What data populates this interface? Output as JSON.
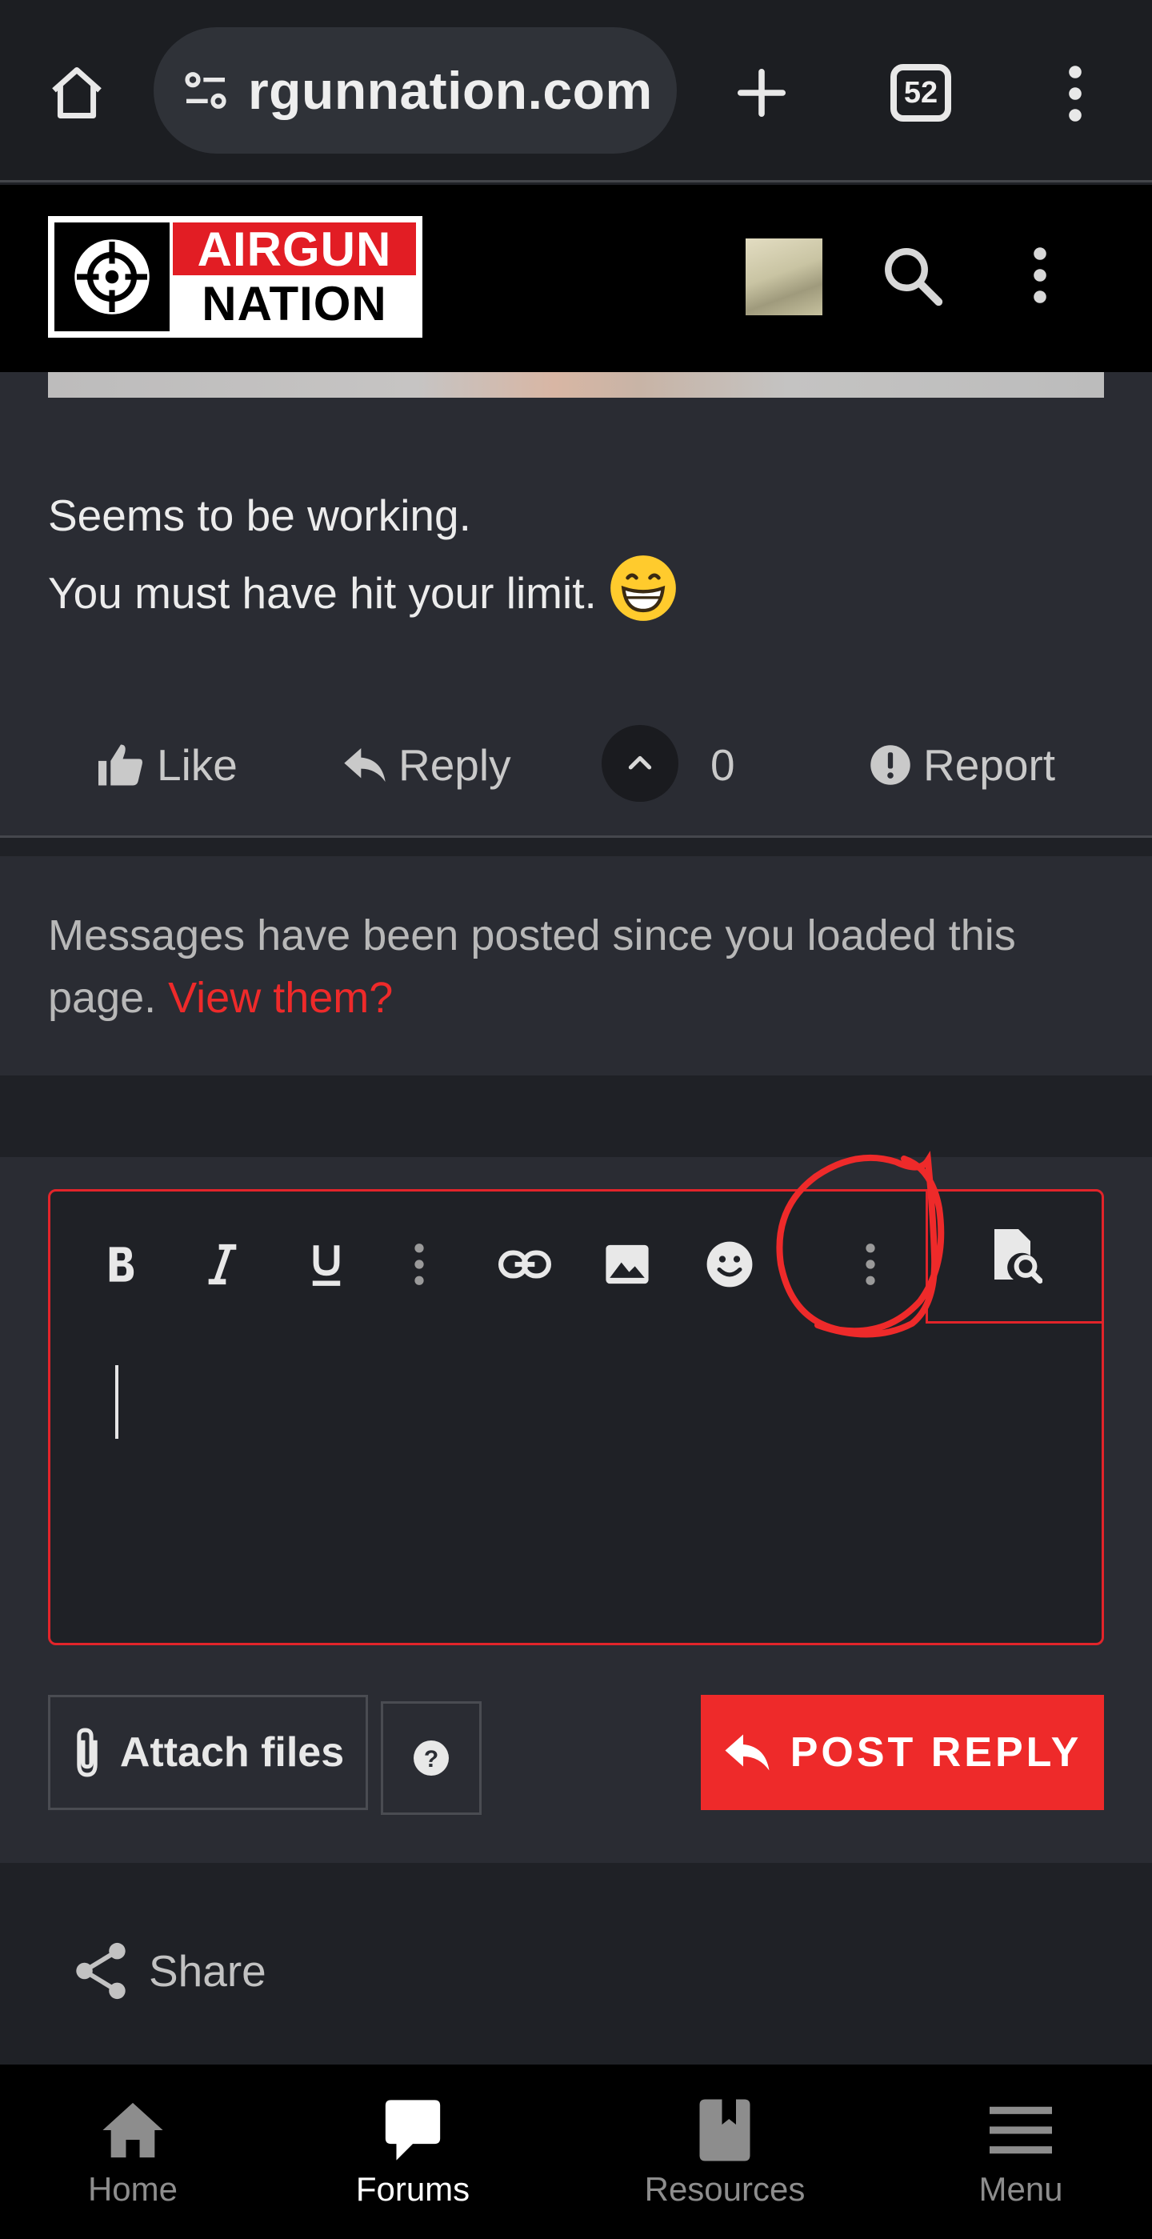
{
  "browser": {
    "url": "rgunnation.com",
    "tab_count": "52"
  },
  "site": {
    "logo_top": "AIRGUN",
    "logo_bottom": "NATION"
  },
  "post": {
    "line1": "Seems to be working.",
    "line2": "You must have hit your limit.",
    "actions": {
      "like": "Like",
      "reply": "Reply",
      "vote_count": "0",
      "report": "Report"
    }
  },
  "notice": {
    "text": "Messages have been posted since you loaded this page. ",
    "link": "View them?"
  },
  "editor": {
    "toolbar": [
      "bold",
      "italic",
      "underline",
      "more",
      "link",
      "image",
      "emoji",
      "more",
      "preview"
    ],
    "attach_label": "Attach files",
    "help_label": "?",
    "post_reply_label": "POST REPLY"
  },
  "share": {
    "label": "Share"
  },
  "bottom_nav": [
    {
      "label": "Home",
      "icon": "home-icon"
    },
    {
      "label": "Forums",
      "icon": "forums-icon",
      "active": true
    },
    {
      "label": "Resources",
      "icon": "resources-icon"
    },
    {
      "label": "Menu",
      "icon": "menu-icon"
    }
  ],
  "colors": {
    "accent": "#ee2a2a",
    "background": "#1f2126",
    "panel": "#2a2c33"
  }
}
